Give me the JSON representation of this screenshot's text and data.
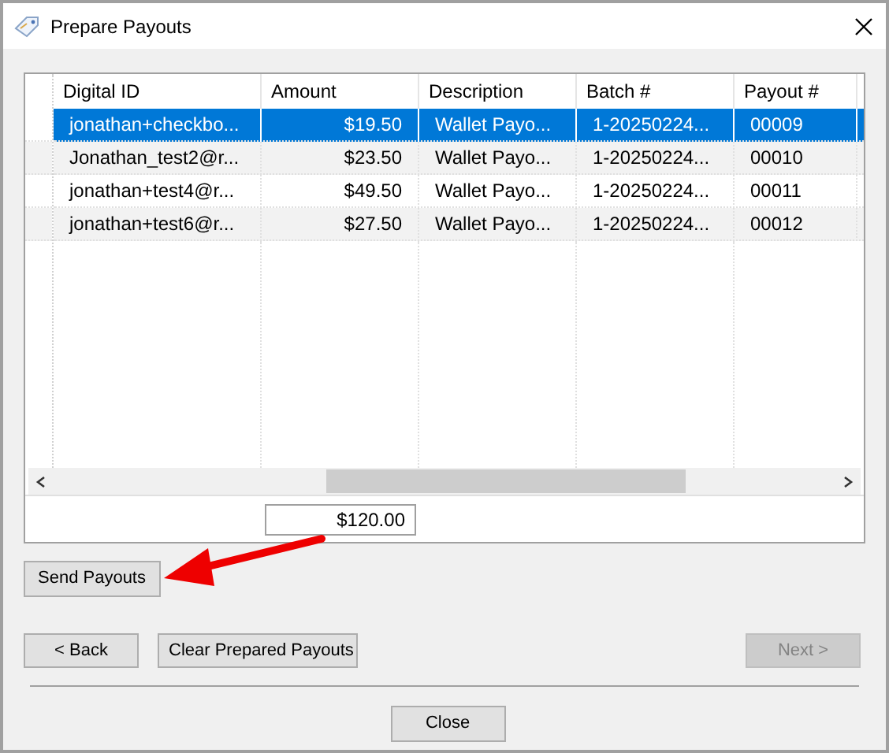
{
  "window": {
    "title": "Prepare Payouts"
  },
  "table": {
    "columns": [
      "Digital ID",
      "Amount",
      "Description",
      "Batch #",
      "Payout #"
    ],
    "rows": [
      {
        "cells": [
          "jonathan+checkbo...",
          "$19.50",
          "Wallet Payo...",
          "1-20250224...",
          "00009"
        ],
        "selected": true
      },
      {
        "cells": [
          "Jonathan_test2@r...",
          "$23.50",
          "Wallet Payo...",
          "1-20250224...",
          "00010"
        ],
        "selected": false
      },
      {
        "cells": [
          "jonathan+test4@r...",
          "$49.50",
          "Wallet Payo...",
          "1-20250224...",
          "00011"
        ],
        "selected": false
      },
      {
        "cells": [
          "jonathan+test6@r...",
          "$27.50",
          "Wallet Payo...",
          "1-20250224...",
          "00012"
        ],
        "selected": false
      }
    ]
  },
  "total": "$120.00",
  "send_button": {
    "label": "Send Payouts",
    "disabled": false
  },
  "nav_buttons": [
    {
      "label": "< Back",
      "disabled": false
    },
    {
      "label": "Clear Prepared Payouts",
      "disabled": false
    },
    {
      "label": "Next >",
      "disabled": true
    }
  ],
  "close_button": {
    "label": "Close",
    "disabled": false
  }
}
